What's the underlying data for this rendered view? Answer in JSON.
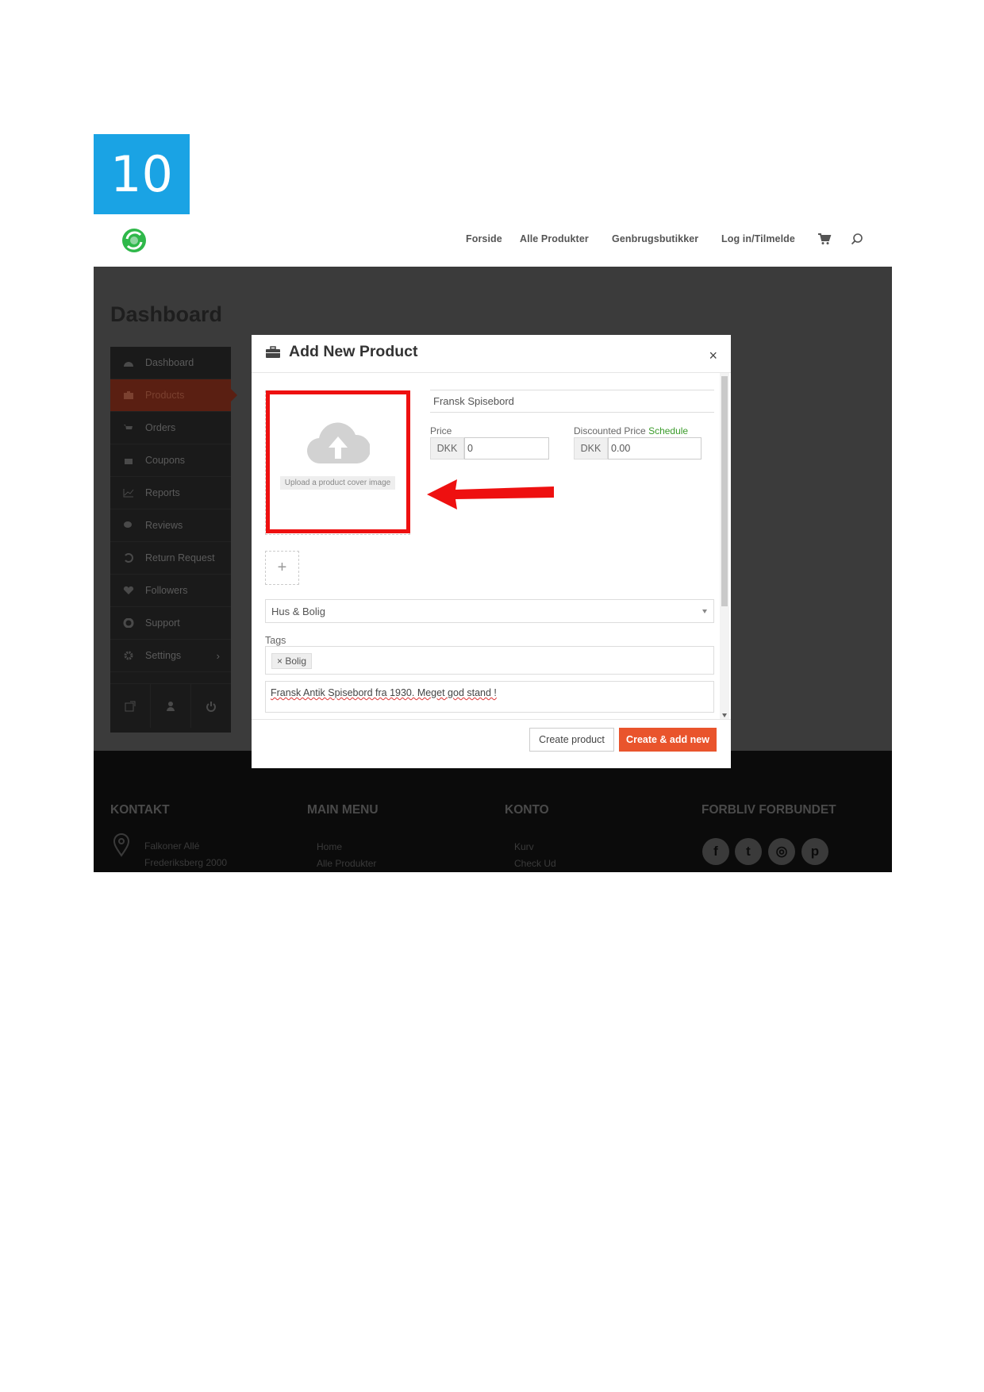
{
  "step": {
    "number": "10"
  },
  "header": {
    "nav": [
      "Forside",
      "Alle Produkter",
      "Genbrugsbutikker",
      "Log in/Tilmelde"
    ]
  },
  "dashboard": {
    "title": "Dashboard",
    "sidebar": [
      {
        "label": "Dashboard",
        "icon": "dashboard-icon"
      },
      {
        "label": "Products",
        "icon": "briefcase-icon",
        "active": true
      },
      {
        "label": "Orders",
        "icon": "cart-icon"
      },
      {
        "label": "Coupons",
        "icon": "gift-icon"
      },
      {
        "label": "Reports",
        "icon": "chart-icon"
      },
      {
        "label": "Reviews",
        "icon": "comments-icon"
      },
      {
        "label": "Return Request",
        "icon": "undo-icon"
      },
      {
        "label": "Followers",
        "icon": "heart-icon"
      },
      {
        "label": "Support",
        "icon": "lifebuoy-icon"
      },
      {
        "label": "Settings",
        "icon": "gear-icon",
        "chevron": "›"
      }
    ]
  },
  "modal": {
    "title": "Add New Product",
    "close": "×",
    "cover_label": "Upload a product cover image",
    "product_title": "Fransk Spisebord",
    "price_label": "Price",
    "price_currency": "DKK",
    "price_value": "0",
    "discount_label": "Discounted Price",
    "discount_link": "Schedule",
    "discount_currency": "DKK",
    "discount_value": "0.00",
    "gallery_add": "+",
    "category": "Hus & Bolig",
    "tags_label": "Tags",
    "tag": "× Bolig",
    "description": "Fransk Antik Spisebord fra 1930. Meget god stand !",
    "btn_create": "Create product",
    "btn_create_new": "Create & add new"
  },
  "footer": {
    "columns": [
      "KONTAKT",
      "MAIN MENU",
      "KONTO",
      "FORBLIV FORBUNDET"
    ],
    "address": [
      "Falkoner Allé",
      "Frederiksberg 2000"
    ],
    "menu_links": [
      "Home",
      "Alle Produkter"
    ],
    "konto_links": [
      "Kurv",
      "Check Ud"
    ],
    "social": [
      "f",
      "t",
      "◎",
      "p"
    ]
  },
  "colors": {
    "badge": "#1aa3e4",
    "accent": "#e9542c",
    "highlight": "#ee1010",
    "schedule_link": "#3a9b2a"
  }
}
